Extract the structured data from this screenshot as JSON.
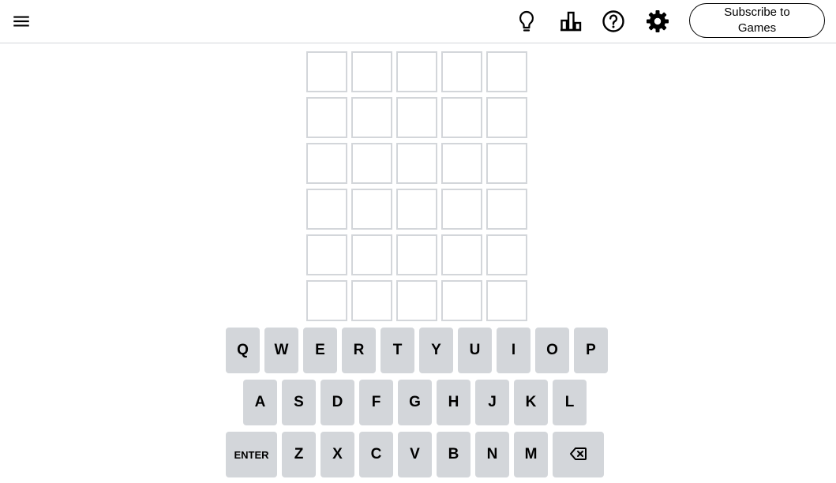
{
  "header": {
    "menu_icon": "hamburger-menu-icon",
    "hint_icon": "lightbulb-icon",
    "stats_icon": "bar-chart-icon",
    "help_icon": "question-circle-icon",
    "settings_icon": "gear-icon",
    "subscribe_label": "Subscribe to Games"
  },
  "board": {
    "rows": [
      [
        "",
        "",
        "",
        "",
        ""
      ],
      [
        "",
        "",
        "",
        "",
        ""
      ],
      [
        "",
        "",
        "",
        "",
        ""
      ],
      [
        "",
        "",
        "",
        "",
        ""
      ],
      [
        "",
        "",
        "",
        "",
        ""
      ],
      [
        "",
        "",
        "",
        "",
        ""
      ]
    ]
  },
  "keyboard": {
    "row1": [
      "Q",
      "W",
      "E",
      "R",
      "T",
      "Y",
      "U",
      "I",
      "O",
      "P"
    ],
    "row2": [
      "A",
      "S",
      "D",
      "F",
      "G",
      "H",
      "J",
      "K",
      "L"
    ],
    "row3": [
      "ENTER",
      "Z",
      "X",
      "C",
      "V",
      "B",
      "N",
      "M",
      "backspace-icon"
    ]
  },
  "colors": {
    "tile_border": "#d3d6da",
    "key_background": "#d3d6da",
    "header_border": "#d3d6da"
  }
}
